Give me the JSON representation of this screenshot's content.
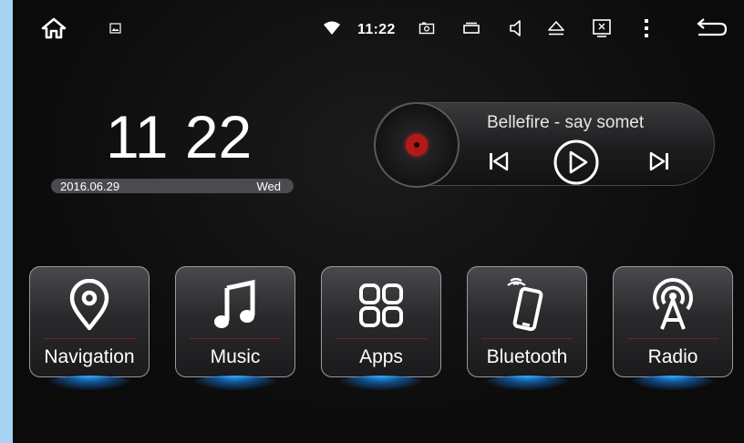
{
  "status_bar": {
    "time": "11:22",
    "icons": [
      "home-icon",
      "gallery-icon",
      "wifi-icon",
      "screenshot-icon",
      "recent-apps-icon",
      "volume-icon",
      "eject-icon",
      "close-window-icon",
      "menu-icon",
      "back-icon"
    ]
  },
  "clock": {
    "time": "11 22",
    "date": "2016.06.29",
    "weekday": "Wed"
  },
  "player": {
    "song": "Bellefire - say somet",
    "controls": [
      "previous-icon",
      "play-icon",
      "next-icon"
    ]
  },
  "apps": [
    {
      "label": "Navigation",
      "icon": "location-pin-icon"
    },
    {
      "label": "Music",
      "icon": "music-note-icon"
    },
    {
      "label": "Apps",
      "icon": "apps-grid-icon"
    },
    {
      "label": "Bluetooth",
      "icon": "bluetooth-phone-icon"
    },
    {
      "label": "Radio",
      "icon": "radio-tower-icon"
    }
  ],
  "colors": {
    "accent_glow": "#2aa8ff",
    "disc_label": "#b01a17",
    "background": "#0b0b0c"
  }
}
